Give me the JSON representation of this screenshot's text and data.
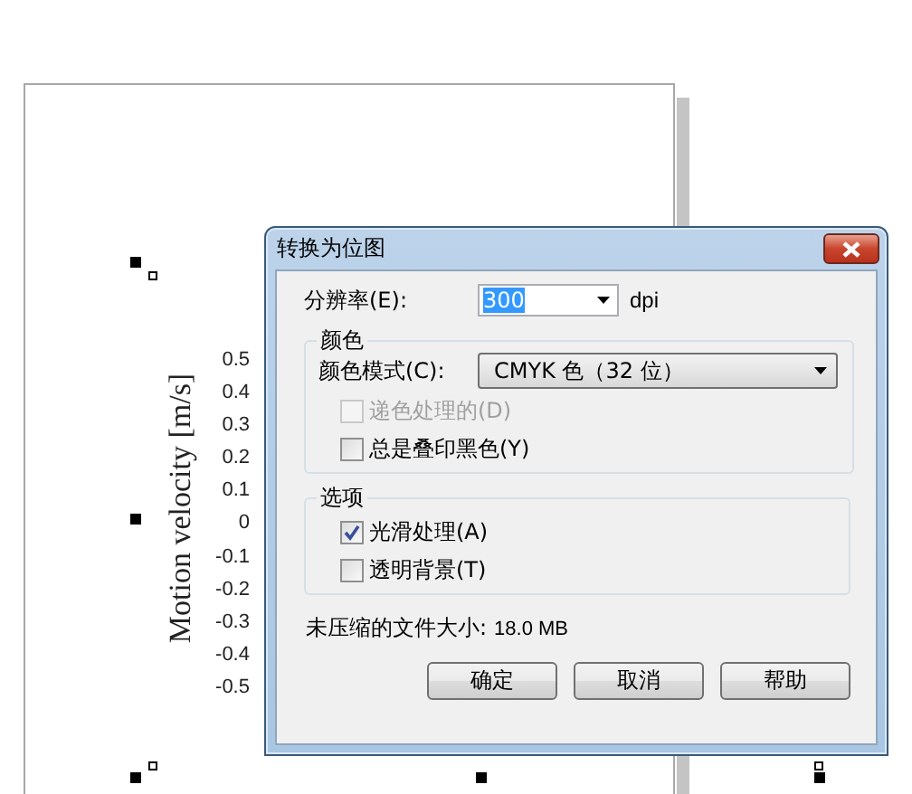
{
  "document": {
    "axis_title": "Motion velocity [m/s]",
    "tick_labels": [
      "0.5",
      "0.4",
      "0.3",
      "0.2",
      "0.1",
      "0",
      "-0.1",
      "-0.2",
      "-0.3",
      "-0.4",
      "-0.5"
    ]
  },
  "dialog": {
    "title": "转换为位图",
    "resolution": {
      "label": "分辨率(E):",
      "value": "300",
      "text_selected": true,
      "unit": "dpi"
    },
    "groups": [
      {
        "title": "颜色",
        "items": [
          {
            "kind": "dropdown",
            "label": "颜色模式(C):",
            "value": "CMYK 色（32 位）"
          },
          {
            "kind": "checkbox",
            "label": "递色处理的(D)",
            "checked": false,
            "disabled": true
          },
          {
            "kind": "checkbox",
            "label": "总是叠印黑色(Y)",
            "checked": false,
            "disabled": false
          }
        ]
      },
      {
        "title": "选项",
        "items": [
          {
            "kind": "checkbox",
            "label": "光滑处理(A)",
            "checked": true,
            "disabled": false
          },
          {
            "kind": "checkbox",
            "label": "透明背景(T)",
            "checked": false,
            "disabled": false
          }
        ]
      }
    ],
    "file_size": {
      "label": "未压缩的文件大小:",
      "value": "18.0 MB"
    },
    "buttons": [
      "确定",
      "取消",
      "帮助"
    ]
  }
}
